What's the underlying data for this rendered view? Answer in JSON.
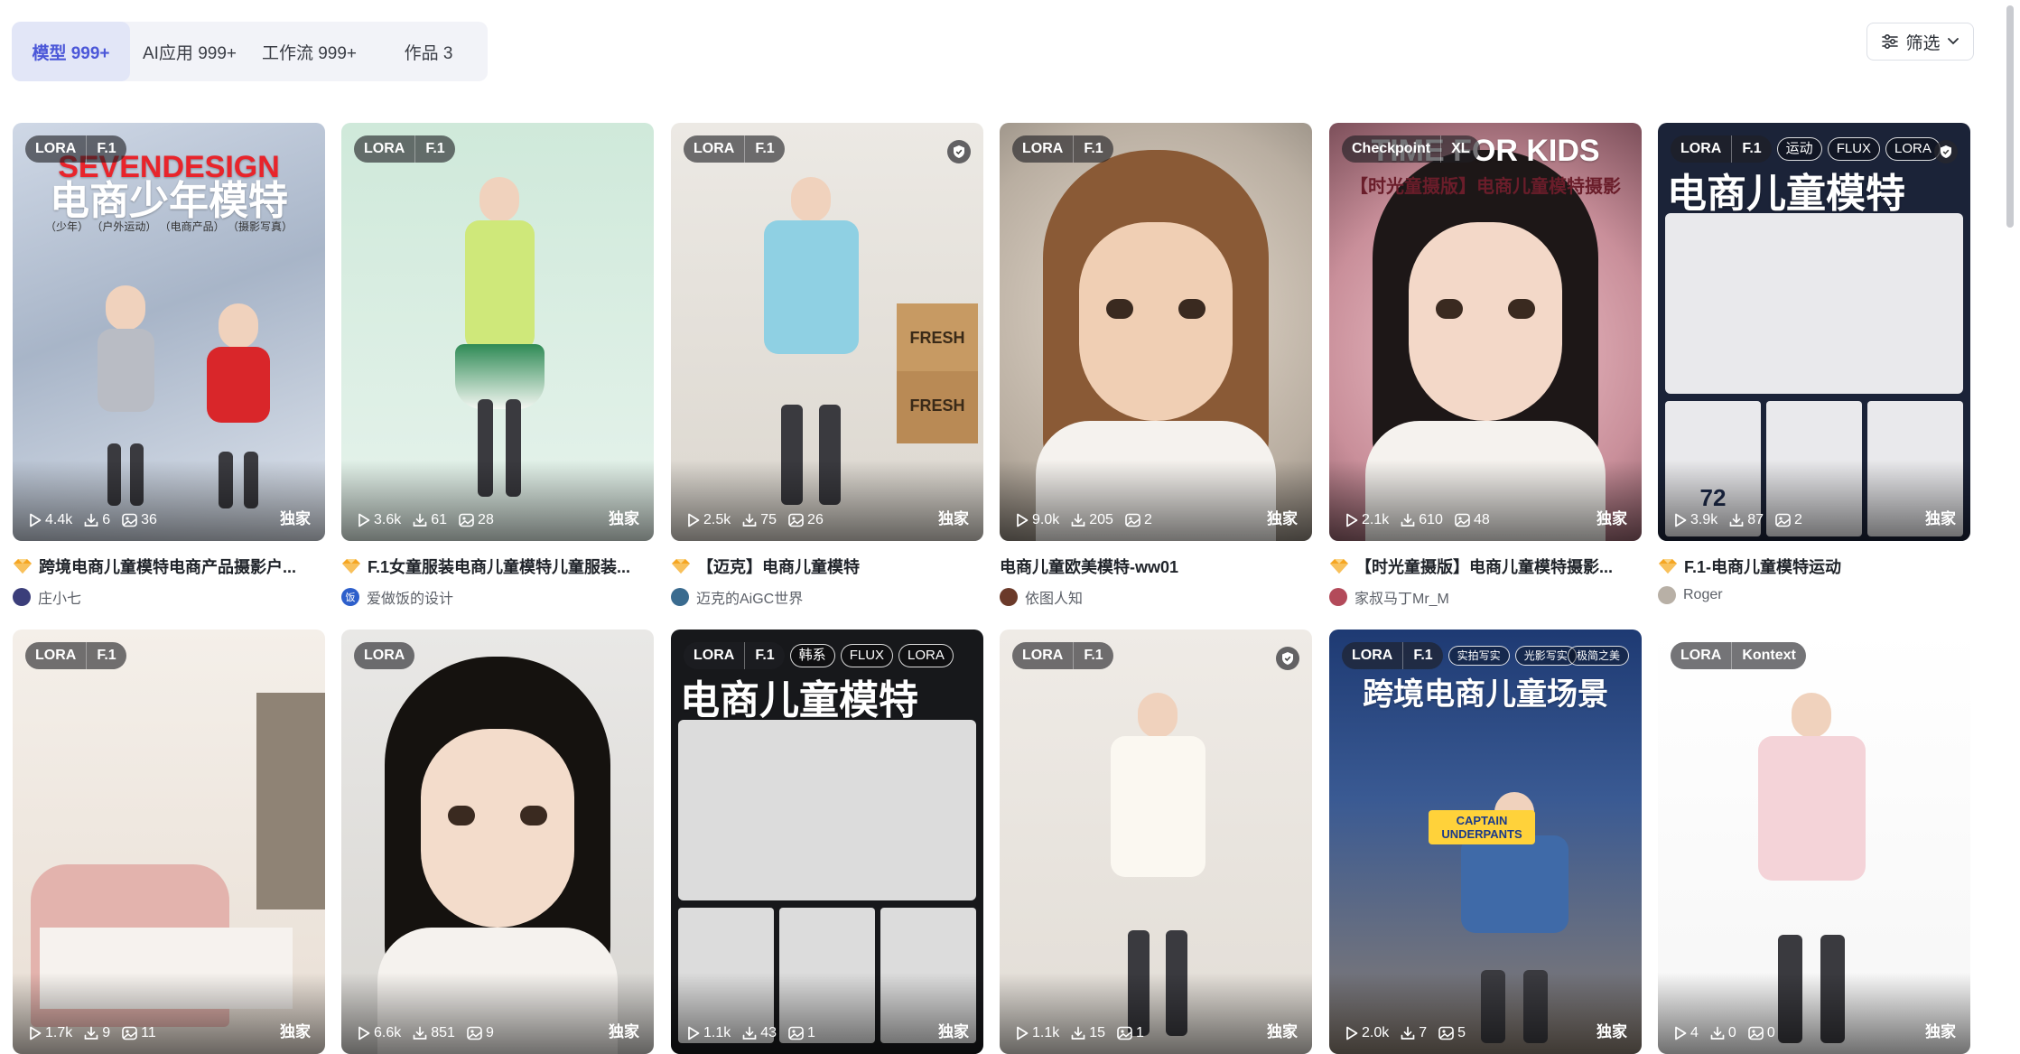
{
  "tabs": [
    {
      "label": "模型 999+",
      "active": true
    },
    {
      "label": "AI应用 999+",
      "active": false
    },
    {
      "label": "工作流 999+",
      "active": false
    },
    {
      "label": "作品 3",
      "active": false
    }
  ],
  "filter": {
    "label": "筛选",
    "icon": "sliders-icon"
  },
  "colors": {
    "accent": "#4b57d8",
    "badge_orange": "#f5a623"
  },
  "cards": [
    {
      "tags": [
        "LORA",
        "F.1"
      ],
      "extra_pills": [],
      "shield": false,
      "overlay": {
        "title": "电商少年模特",
        "banner": "SEVENDESIGN",
        "sub": "（少年） （户外运动） （电商产品） （摄影写真）"
      },
      "stats": {
        "runs": "4.4k",
        "downloads": "6",
        "images": "36"
      },
      "exclusive": "独家",
      "badge": true,
      "title": "跨境电商儿童模特电商产品摄影户...",
      "author": "庄小七"
    },
    {
      "tags": [
        "LORA",
        "F.1"
      ],
      "extra_pills": [],
      "shield": false,
      "overlay": null,
      "stats": {
        "runs": "3.6k",
        "downloads": "61",
        "images": "28"
      },
      "exclusive": "独家",
      "badge": true,
      "title": "F.1女童服装电商儿童模特儿童服装...",
      "author": "爱做饭的设计",
      "author_avatar_text": "饭"
    },
    {
      "tags": [
        "LORA",
        "F.1"
      ],
      "extra_pills": [],
      "shield": true,
      "overlay": {
        "box1": "FRESH",
        "box2": "FRESH"
      },
      "stats": {
        "runs": "2.5k",
        "downloads": "75",
        "images": "26"
      },
      "exclusive": "独家",
      "badge": true,
      "title": "【迈克】电商儿童模特",
      "author": "迈克的AiGC世界"
    },
    {
      "tags": [
        "LORA",
        "F.1"
      ],
      "extra_pills": [],
      "shield": false,
      "overlay": null,
      "stats": {
        "runs": "9.0k",
        "downloads": "205",
        "images": "2"
      },
      "exclusive": "独家",
      "badge": false,
      "title": "电商儿童欧美模特-ww01",
      "author": "依图人知"
    },
    {
      "tags": [
        "Checkpoint",
        "XL"
      ],
      "extra_pills": [],
      "shield": false,
      "overlay": {
        "banner": "TIME FOR KIDS",
        "sub": "【时光童摄版】电商儿童模特摄影"
      },
      "stats": {
        "runs": "2.1k",
        "downloads": "610",
        "images": "48"
      },
      "exclusive": "独家",
      "badge": true,
      "title": "【时光童摄版】电商儿童模特摄影...",
      "author": "家叔马丁Mr_M"
    },
    {
      "tags": [
        "LORA",
        "F.1"
      ],
      "extra_pills": [
        "运动",
        "FLUX",
        "LORA"
      ],
      "shield": true,
      "overlay": {
        "title": "电商儿童模特",
        "jersey": "72"
      },
      "stats": {
        "runs": "3.9k",
        "downloads": "87",
        "images": "2"
      },
      "exclusive": "独家",
      "badge": true,
      "title": "F.1-电商儿童模特运动",
      "author": "Roger"
    },
    {
      "tags": [
        "LORA",
        "F.1"
      ],
      "extra_pills": [],
      "shield": false,
      "overlay": null,
      "stats": {
        "runs": "1.7k",
        "downloads": "9",
        "images": "11"
      },
      "exclusive": "独家"
    },
    {
      "tags": [
        "LORA"
      ],
      "extra_pills": [],
      "shield": false,
      "overlay": null,
      "stats": {
        "runs": "6.6k",
        "downloads": "851",
        "images": "9"
      },
      "exclusive": "独家"
    },
    {
      "tags": [
        "LORA",
        "F.1"
      ],
      "extra_pills": [
        "韩系",
        "FLUX",
        "LORA"
      ],
      "shield": false,
      "overlay": {
        "title": "电商儿童模特"
      },
      "stats": {
        "runs": "1.1k",
        "downloads": "43",
        "images": "1"
      },
      "exclusive": "独家"
    },
    {
      "tags": [
        "LORA",
        "F.1"
      ],
      "extra_pills": [],
      "shield": true,
      "overlay": null,
      "stats": {
        "runs": "1.1k",
        "downloads": "15",
        "images": "1"
      },
      "exclusive": "独家"
    },
    {
      "tags": [
        "LORA",
        "F.1"
      ],
      "extra_pills": [
        "实拍写实",
        "光影写实"
      ],
      "corner_label": "极简之美",
      "shield": false,
      "overlay": {
        "title": "跨境电商儿童场景",
        "book": "CAPTAIN UNDERPANTS"
      },
      "stats": {
        "runs": "2.0k",
        "downloads": "7",
        "images": "5"
      },
      "exclusive": "独家"
    },
    {
      "tags": [
        "LORA",
        "Kontext"
      ],
      "extra_pills": [],
      "shield": false,
      "overlay": null,
      "stats": {
        "runs": "4",
        "downloads": "0",
        "images": "0"
      },
      "exclusive": "独家"
    }
  ]
}
